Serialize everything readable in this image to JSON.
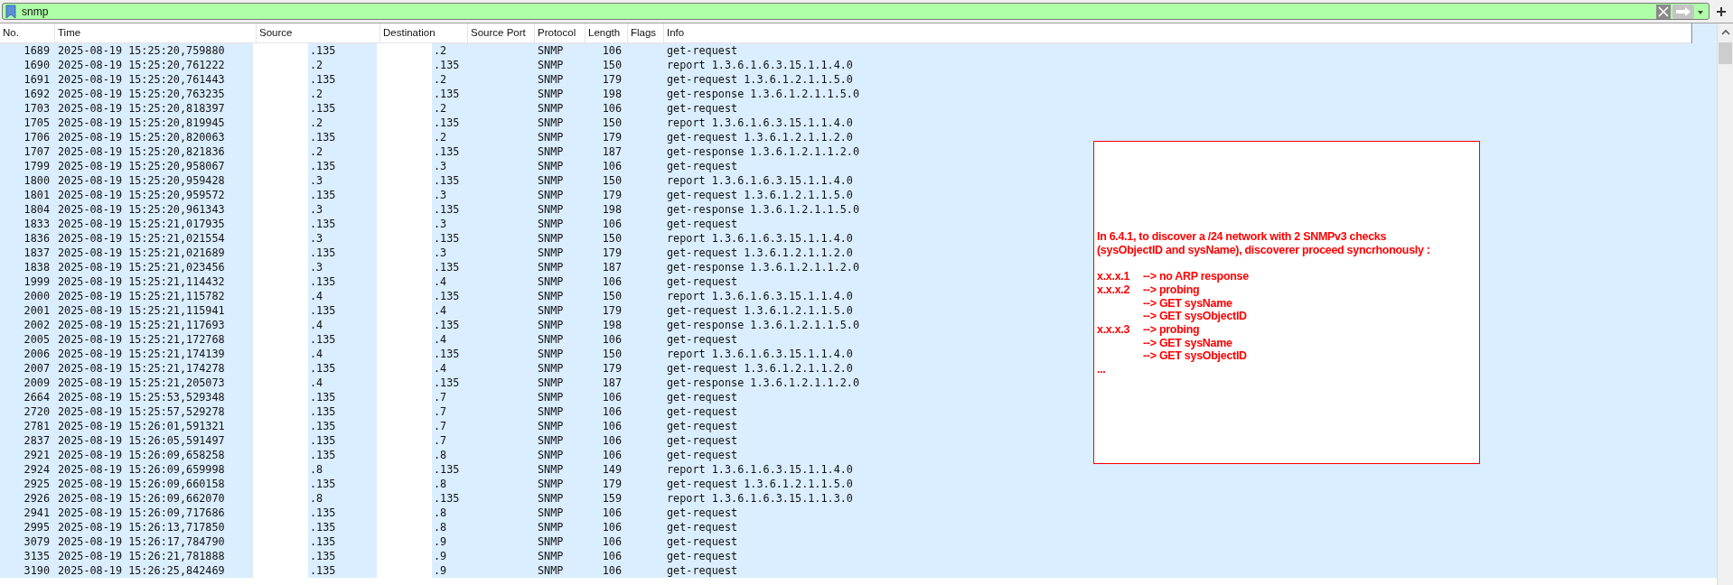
{
  "filter": {
    "value": "snmp"
  },
  "columns": [
    {
      "kind": "no",
      "label": "No."
    },
    {
      "kind": "time",
      "label": "Time"
    },
    {
      "kind": "source",
      "label": "Source"
    },
    {
      "kind": "destination",
      "label": "Destination"
    },
    {
      "kind": "srcport",
      "label": "Source Port"
    },
    {
      "kind": "protocol",
      "label": "Protocol"
    },
    {
      "kind": "length",
      "label": "Length"
    },
    {
      "kind": "flags",
      "label": "Flags"
    },
    {
      "kind": "info",
      "label": "Info"
    }
  ],
  "packets": [
    {
      "no": "1689",
      "time": "2025-08-19 15:25:20,759880",
      "source": ".135",
      "destination": ".2",
      "protocol": "SNMP",
      "length": "106",
      "info": "get-request"
    },
    {
      "no": "1690",
      "time": "2025-08-19 15:25:20,761222",
      "source": ".2",
      "destination": ".135",
      "protocol": "SNMP",
      "length": "150",
      "info": "report 1.3.6.1.6.3.15.1.1.4.0"
    },
    {
      "no": "1691",
      "time": "2025-08-19 15:25:20,761443",
      "source": ".135",
      "destination": ".2",
      "protocol": "SNMP",
      "length": "179",
      "info": "get-request 1.3.6.1.2.1.1.5.0"
    },
    {
      "no": "1692",
      "time": "2025-08-19 15:25:20,763235",
      "source": ".2",
      "destination": ".135",
      "protocol": "SNMP",
      "length": "198",
      "info": "get-response 1.3.6.1.2.1.1.5.0"
    },
    {
      "no": "1703",
      "time": "2025-08-19 15:25:20,818397",
      "source": ".135",
      "destination": ".2",
      "protocol": "SNMP",
      "length": "106",
      "info": "get-request"
    },
    {
      "no": "1705",
      "time": "2025-08-19 15:25:20,819945",
      "source": ".2",
      "destination": ".135",
      "protocol": "SNMP",
      "length": "150",
      "info": "report 1.3.6.1.6.3.15.1.1.4.0"
    },
    {
      "no": "1706",
      "time": "2025-08-19 15:25:20,820063",
      "source": ".135",
      "destination": ".2",
      "protocol": "SNMP",
      "length": "179",
      "info": "get-request 1.3.6.1.2.1.1.2.0"
    },
    {
      "no": "1707",
      "time": "2025-08-19 15:25:20,821836",
      "source": ".2",
      "destination": ".135",
      "protocol": "SNMP",
      "length": "187",
      "info": "get-response 1.3.6.1.2.1.1.2.0"
    },
    {
      "no": "1799",
      "time": "2025-08-19 15:25:20,958067",
      "source": ".135",
      "destination": ".3",
      "protocol": "SNMP",
      "length": "106",
      "info": "get-request"
    },
    {
      "no": "1800",
      "time": "2025-08-19 15:25:20,959428",
      "source": ".3",
      "destination": ".135",
      "protocol": "SNMP",
      "length": "150",
      "info": "report 1.3.6.1.6.3.15.1.1.4.0"
    },
    {
      "no": "1801",
      "time": "2025-08-19 15:25:20,959572",
      "source": ".135",
      "destination": ".3",
      "protocol": "SNMP",
      "length": "179",
      "info": "get-request 1.3.6.1.2.1.1.5.0"
    },
    {
      "no": "1804",
      "time": "2025-08-19 15:25:20,961343",
      "source": ".3",
      "destination": ".135",
      "protocol": "SNMP",
      "length": "198",
      "info": "get-response 1.3.6.1.2.1.1.5.0"
    },
    {
      "no": "1833",
      "time": "2025-08-19 15:25:21,017935",
      "source": ".135",
      "destination": ".3",
      "protocol": "SNMP",
      "length": "106",
      "info": "get-request"
    },
    {
      "no": "1836",
      "time": "2025-08-19 15:25:21,021554",
      "source": ".3",
      "destination": ".135",
      "protocol": "SNMP",
      "length": "150",
      "info": "report 1.3.6.1.6.3.15.1.1.4.0"
    },
    {
      "no": "1837",
      "time": "2025-08-19 15:25:21,021689",
      "source": ".135",
      "destination": ".3",
      "protocol": "SNMP",
      "length": "179",
      "info": "get-request 1.3.6.1.2.1.1.2.0"
    },
    {
      "no": "1838",
      "time": "2025-08-19 15:25:21,023456",
      "source": ".3",
      "destination": ".135",
      "protocol": "SNMP",
      "length": "187",
      "info": "get-response 1.3.6.1.2.1.1.2.0"
    },
    {
      "no": "1999",
      "time": "2025-08-19 15:25:21,114432",
      "source": ".135",
      "destination": ".4",
      "protocol": "SNMP",
      "length": "106",
      "info": "get-request"
    },
    {
      "no": "2000",
      "time": "2025-08-19 15:25:21,115782",
      "source": ".4",
      "destination": ".135",
      "protocol": "SNMP",
      "length": "150",
      "info": "report 1.3.6.1.6.3.15.1.1.4.0"
    },
    {
      "no": "2001",
      "time": "2025-08-19 15:25:21,115941",
      "source": ".135",
      "destination": ".4",
      "protocol": "SNMP",
      "length": "179",
      "info": "get-request 1.3.6.1.2.1.1.5.0"
    },
    {
      "no": "2002",
      "time": "2025-08-19 15:25:21,117693",
      "source": ".4",
      "destination": ".135",
      "protocol": "SNMP",
      "length": "198",
      "info": "get-response 1.3.6.1.2.1.1.5.0"
    },
    {
      "no": "2005",
      "time": "2025-08-19 15:25:21,172768",
      "source": ".135",
      "destination": ".4",
      "protocol": "SNMP",
      "length": "106",
      "info": "get-request"
    },
    {
      "no": "2006",
      "time": "2025-08-19 15:25:21,174139",
      "source": ".4",
      "destination": ".135",
      "protocol": "SNMP",
      "length": "150",
      "info": "report 1.3.6.1.6.3.15.1.1.4.0"
    },
    {
      "no": "2007",
      "time": "2025-08-19 15:25:21,174278",
      "source": ".135",
      "destination": ".4",
      "protocol": "SNMP",
      "length": "179",
      "info": "get-request 1.3.6.1.2.1.1.2.0"
    },
    {
      "no": "2009",
      "time": "2025-08-19 15:25:21,205073",
      "source": ".4",
      "destination": ".135",
      "protocol": "SNMP",
      "length": "187",
      "info": "get-response 1.3.6.1.2.1.1.2.0"
    },
    {
      "no": "2664",
      "time": "2025-08-19 15:25:53,529348",
      "source": ".135",
      "destination": ".7",
      "protocol": "SNMP",
      "length": "106",
      "info": "get-request"
    },
    {
      "no": "2720",
      "time": "2025-08-19 15:25:57,529278",
      "source": ".135",
      "destination": ".7",
      "protocol": "SNMP",
      "length": "106",
      "info": "get-request"
    },
    {
      "no": "2781",
      "time": "2025-08-19 15:26:01,591321",
      "source": ".135",
      "destination": ".7",
      "protocol": "SNMP",
      "length": "106",
      "info": "get-request"
    },
    {
      "no": "2837",
      "time": "2025-08-19 15:26:05,591497",
      "source": ".135",
      "destination": ".7",
      "protocol": "SNMP",
      "length": "106",
      "info": "get-request"
    },
    {
      "no": "2921",
      "time": "2025-08-19 15:26:09,658258",
      "source": ".135",
      "destination": ".8",
      "protocol": "SNMP",
      "length": "106",
      "info": "get-request"
    },
    {
      "no": "2924",
      "time": "2025-08-19 15:26:09,659998",
      "source": ".8",
      "destination": ".135",
      "protocol": "SNMP",
      "length": "149",
      "info": "report 1.3.6.1.6.3.15.1.1.4.0"
    },
    {
      "no": "2925",
      "time": "2025-08-19 15:26:09,660158",
      "source": ".135",
      "destination": ".8",
      "protocol": "SNMP",
      "length": "179",
      "info": "get-request 1.3.6.1.2.1.1.5.0"
    },
    {
      "no": "2926",
      "time": "2025-08-19 15:26:09,662070",
      "source": ".8",
      "destination": ".135",
      "protocol": "SNMP",
      "length": "159",
      "info": "report 1.3.6.1.6.3.15.1.1.3.0"
    },
    {
      "no": "2941",
      "time": "2025-08-19 15:26:09,717686",
      "source": ".135",
      "destination": ".8",
      "protocol": "SNMP",
      "length": "106",
      "info": "get-request"
    },
    {
      "no": "2995",
      "time": "2025-08-19 15:26:13,717850",
      "source": ".135",
      "destination": ".8",
      "protocol": "SNMP",
      "length": "106",
      "info": "get-request"
    },
    {
      "no": "3079",
      "time": "2025-08-19 15:26:17,784790",
      "source": ".135",
      "destination": ".9",
      "protocol": "SNMP",
      "length": "106",
      "info": "get-request"
    },
    {
      "no": "3135",
      "time": "2025-08-19 15:26:21,781888",
      "source": ".135",
      "destination": ".9",
      "protocol": "SNMP",
      "length": "106",
      "info": "get-request"
    },
    {
      "no": "3190",
      "time": "2025-08-19 15:26:25,842469",
      "source": ".135",
      "destination": ".9",
      "protocol": "SNMP",
      "length": "106",
      "info": "get-request"
    }
  ],
  "annotation": {
    "intro": [
      "In 6.4.1, to discover a /24 network with 2 SNMPv3 checks",
      "(sysObjectID and sysName), discoverer proceed syncrhonously :"
    ],
    "steps": [
      {
        "kind": "host",
        "host": "x.x.x.1",
        "text": "--> no ARP response"
      },
      {
        "kind": "host",
        "host": "x.x.x.2",
        "text": "--> probing"
      },
      {
        "kind": "detail",
        "text": "--> GET sysName"
      },
      {
        "kind": "detail",
        "text": "--> GET sysObjectID"
      },
      {
        "kind": "host",
        "host": "x.x.x.3",
        "text": "--> probing"
      },
      {
        "kind": "detail",
        "text": "--> GET sysName"
      },
      {
        "kind": "detail",
        "text": "--> GET sysObjectID"
      },
      {
        "kind": "ellipsis",
        "text": "..."
      }
    ]
  }
}
